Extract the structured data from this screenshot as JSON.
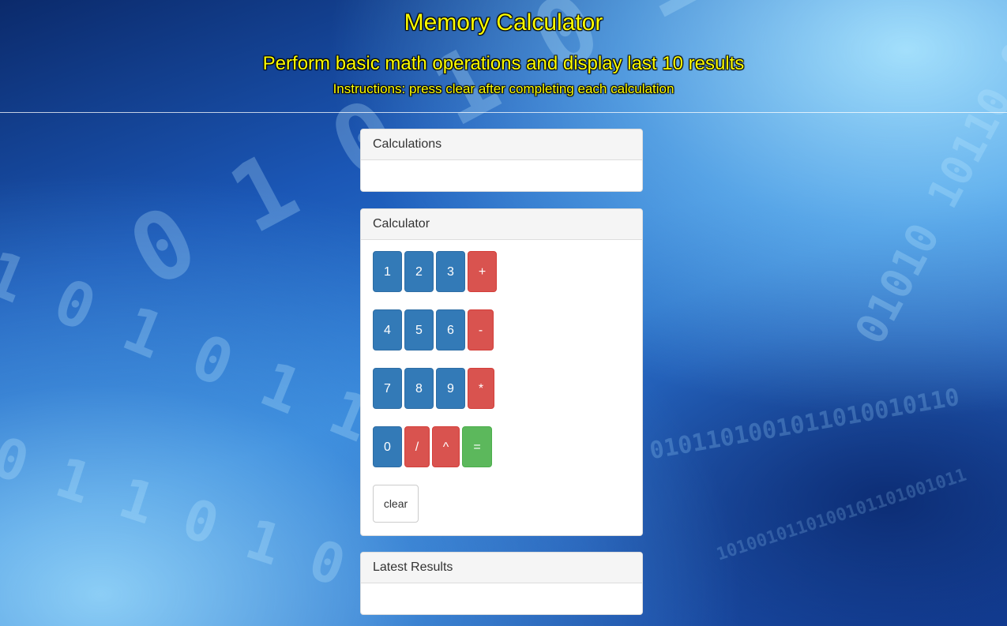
{
  "header": {
    "title": "Memory Calculator",
    "subtitle": "Perform basic math operations and display last 10 results",
    "instructions": "Instructions: press clear after completing each calculation"
  },
  "panels": {
    "calculations": {
      "heading": "Calculations"
    },
    "calculator": {
      "heading": "Calculator"
    },
    "latest_results": {
      "heading": "Latest Results"
    }
  },
  "keypad": {
    "k1": "1",
    "k2": "2",
    "k3": "3",
    "plus": "+",
    "k4": "4",
    "k5": "5",
    "k6": "6",
    "minus": "-",
    "k7": "7",
    "k8": "8",
    "k9": "9",
    "multiply": "*",
    "k0": "0",
    "divide": "/",
    "power": "^",
    "equals": "=",
    "clear": "clear"
  },
  "colors": {
    "title_yellow": "#ffff00",
    "number_blue": "#337ab7",
    "operator_red": "#d9534f",
    "equals_green": "#5cb85c"
  }
}
